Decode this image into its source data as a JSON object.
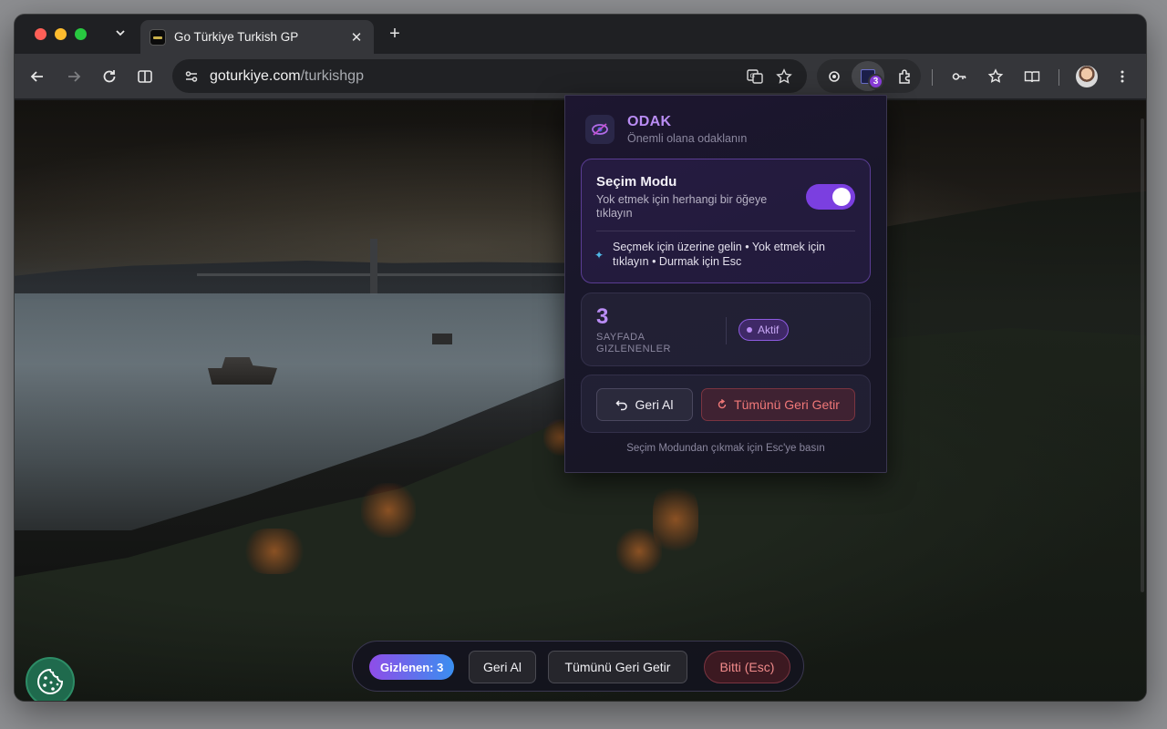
{
  "browser": {
    "tab_title": "Go Türkiye Turkish GP",
    "url_domain": "goturkiye.com",
    "url_path": "/turkishgp",
    "extension_badge": "3"
  },
  "popup": {
    "title": "ODAK",
    "subtitle": "Önemli olana odaklanın",
    "mode": {
      "title": "Seçim Modu",
      "description": "Yok etmek için herhangi bir öğeye tıklayın",
      "toggle_on": true,
      "hint": "Seçmek için üzerine gelin • Yok etmek için tıklayın • Durmak için Esc"
    },
    "stats": {
      "count": "3",
      "label": "SAYFADA GIZLENENLER",
      "status": "Aktif"
    },
    "actions": {
      "undo": "Geri Al",
      "restore_all": "Tümünü Geri Getir"
    },
    "footer": "Seçim Modundan çıkmak için Esc'ye basın"
  },
  "bottom_bar": {
    "count_label": "Gizlenen: 3",
    "undo": "Geri Al",
    "restore_all": "Tümünü Geri Getir",
    "done": "Bitti (Esc)"
  },
  "colors": {
    "accent": "#7b3fe0",
    "accent_text": "#b98cf3",
    "danger_text": "#f07878"
  }
}
